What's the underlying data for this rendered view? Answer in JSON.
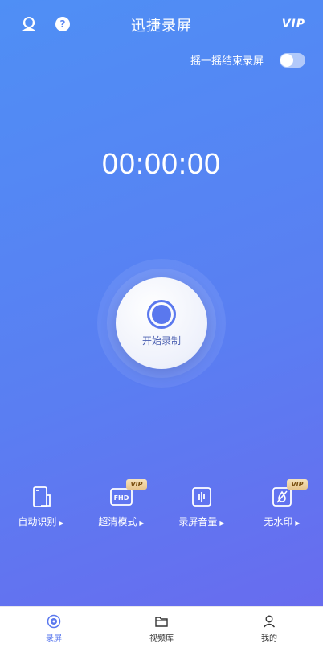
{
  "header": {
    "title": "迅捷录屏",
    "vip_label": "VIP",
    "help_glyph": "?",
    "user_icon": "user-service-icon",
    "help_icon": "help-circle-icon"
  },
  "shake": {
    "label": "摇一摇结束录屏",
    "enabled": false
  },
  "timer": "00:00:00",
  "record_button": {
    "label": "开始录制"
  },
  "features": [
    {
      "label": "自动识别",
      "icon": "phone-rotate-icon",
      "vip": false
    },
    {
      "label": "超清模式",
      "icon": "fhd-icon",
      "icon_text": "FHD",
      "vip": true,
      "badge": "VIP"
    },
    {
      "label": "录屏音量",
      "icon": "volume-bars-icon",
      "vip": false
    },
    {
      "label": "无水印",
      "icon": "no-watermark-icon",
      "vip": true,
      "badge": "VIP"
    }
  ],
  "arrow": "▶",
  "tabs": [
    {
      "label": "录屏",
      "icon": "record-disc-icon",
      "active": true
    },
    {
      "label": "视频库",
      "icon": "folder-icon",
      "active": false
    },
    {
      "label": "我的",
      "icon": "profile-icon",
      "active": false
    }
  ],
  "colors": {
    "gradient_start": "#4f8ff5",
    "gradient_end": "#6a69ee",
    "accent": "#5a78ee",
    "vip_gold": "#e7c58c"
  }
}
